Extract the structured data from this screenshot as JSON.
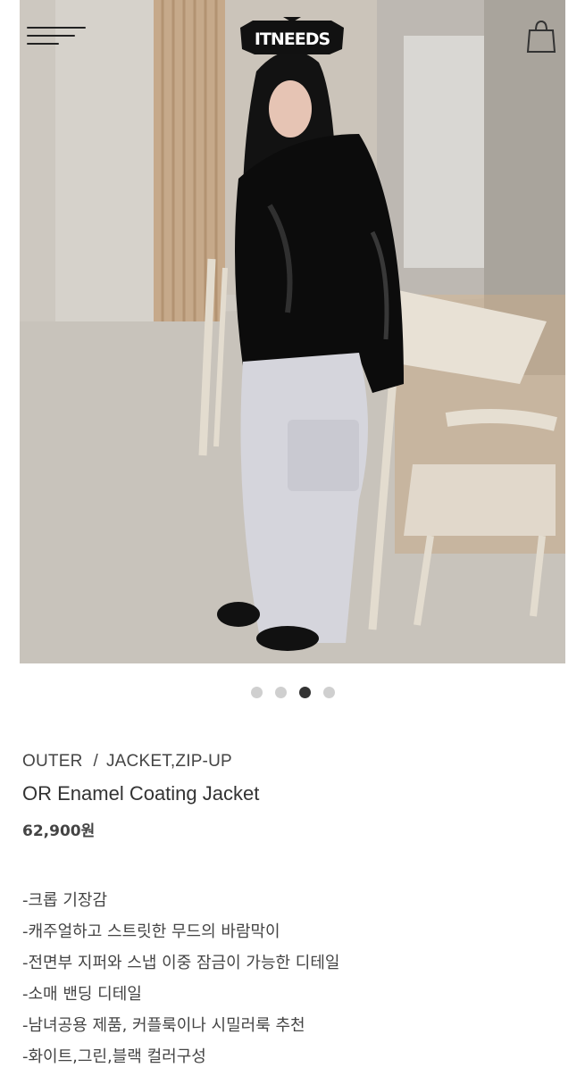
{
  "header": {
    "brand": "ITNEEDS",
    "menu_icon": "hamburger-menu-icon",
    "cart_icon": "shopping-bag-icon"
  },
  "gallery": {
    "slides": 4,
    "active_index": 2
  },
  "product": {
    "category": "OUTER",
    "subcategory": "JACKET,ZIP-UP",
    "separator": "/",
    "name": "OR Enamel Coating Jacket",
    "price": "62,900원",
    "description": [
      "-크롭 기장감",
      "-캐주얼하고 스트릿한 무드의 바람막이",
      "-전면부 지퍼와 스냅 이중 잠금이 가능한 디테일",
      "-소매 밴딩 디테일",
      "-남녀공용 제품, 커플룩이나 시밀러룩 추천",
      "-화이트,그린,블랙 컬러구성"
    ]
  },
  "colors": {
    "dot_active": "#333333",
    "dot_inactive": "#cfcfcf",
    "text": "#444444"
  }
}
